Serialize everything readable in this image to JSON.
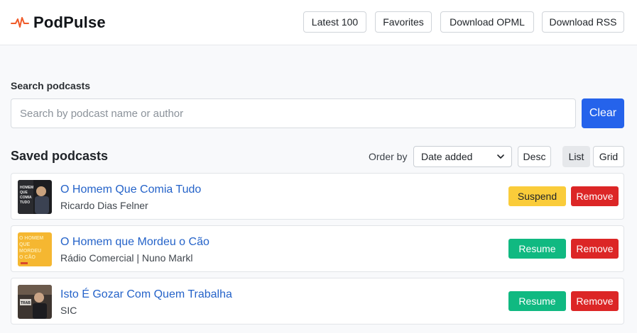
{
  "app": {
    "title": "PodPulse"
  },
  "nav": {
    "latest": "Latest 100",
    "favorites": "Favorites",
    "opml": "Download OPML",
    "rss": "Download RSS"
  },
  "search": {
    "label": "Search podcasts",
    "placeholder": "Search by podcast name or author",
    "value": "",
    "clear": "Clear"
  },
  "saved": {
    "title": "Saved podcasts",
    "order_label": "Order by",
    "order_value": "Date added",
    "direction": "Desc",
    "view_list": "List",
    "view_grid": "Grid",
    "active_view": "List"
  },
  "podcasts": [
    {
      "title": "O Homem Que Comia Tudo",
      "author": "Ricardo Dias Felner",
      "action": "Suspend",
      "remove": "Remove",
      "thumb_text": "HOMEM QUE COMIA TUDO"
    },
    {
      "title": "O Homem que Mordeu o Cão",
      "author": "Rádio Comercial | Nuno Markl",
      "action": "Resume",
      "remove": "Remove",
      "thumb_text": "O HOMEM QUE MORDEU O CÃO"
    },
    {
      "title": "Isto É Gozar Com Quem Trabalha",
      "author": "SIC",
      "action": "Resume",
      "remove": "Remove",
      "thumb_text": "TRABALHA"
    }
  ],
  "colors": {
    "accent": "#2563eb",
    "logo_pulse": "#f05a28",
    "suspend": "#facc3a",
    "resume": "#10b981",
    "remove": "#dc2626",
    "link": "#2563c9"
  }
}
